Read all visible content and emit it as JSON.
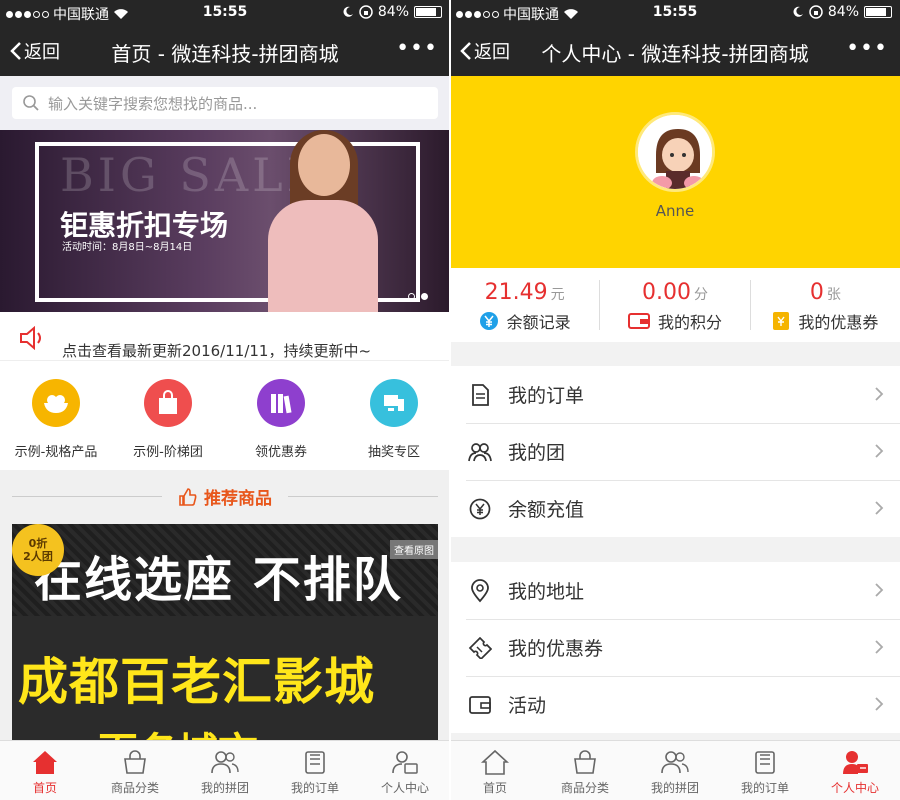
{
  "status": {
    "carrier": "中国联通",
    "time": "15:55",
    "battery": "84%"
  },
  "left": {
    "nav": {
      "back": "返回",
      "title": "首页 - 微连科技-拼团商城",
      "more": "•••"
    },
    "search": {
      "placeholder": "输入关键字搜索您想找的商品..."
    },
    "banner": {
      "big": "BIG SALE",
      "headline_a": "钜惠折扣",
      "headline_b": "专场",
      "sub": "活动时间：8月8日~8月14日"
    },
    "notice": "点击查看最新更新2016/11/11，持续更新中~",
    "shortcuts": [
      {
        "label": "示例-规格产品",
        "color": "#f7b500"
      },
      {
        "label": "示例-阶梯团",
        "color": "#ef4e4e"
      },
      {
        "label": "领优惠券",
        "color": "#8e3fce"
      },
      {
        "label": "抽奖专区",
        "color": "#37c0dd"
      }
    ],
    "recommend_title": "推荐商品",
    "product": {
      "line1": "在线选座 不排队",
      "line2": "成都百老汇影城",
      "line3": "百名城市",
      "view_btn": "查看原图",
      "badge_a": "0折",
      "badge_b": "2人团"
    }
  },
  "right": {
    "nav": {
      "back": "返回",
      "title": "个人中心 - 微连科技-拼团商城",
      "more": "•••"
    },
    "username": "Anne",
    "stats": [
      {
        "value": "21.49",
        "unit": "元",
        "label": "余额记录"
      },
      {
        "value": "0.00",
        "unit": "分",
        "label": "我的积分"
      },
      {
        "value": "0",
        "unit": "张",
        "label": "我的优惠券"
      }
    ],
    "menu1": [
      "我的订单",
      "我的团",
      "余额充值"
    ],
    "menu2": [
      "我的地址",
      "我的优惠券",
      "活动"
    ]
  },
  "tabs": [
    "首页",
    "商品分类",
    "我的拼团",
    "我的订单",
    "个人中心"
  ],
  "colors": {
    "accent": "#e63030",
    "nav_bg": "#262626",
    "profile_bg": "#ffd400",
    "recommend": "#e8571c"
  }
}
